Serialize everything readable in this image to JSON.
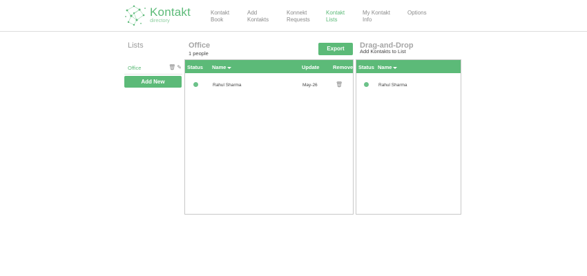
{
  "brand": {
    "name": "Kontakt",
    "tagline": "directory",
    "accent_color": "#5cba78"
  },
  "nav": [
    {
      "label": "Kontakt\nBook"
    },
    {
      "label": "Add\nKontakts"
    },
    {
      "label": "Konnekt\nRequests"
    },
    {
      "label": "Kontakt\nLists",
      "active": true
    },
    {
      "label": "My Kontakt\nInfo"
    },
    {
      "label": "Options"
    }
  ],
  "lists": {
    "title": "Lists",
    "items": [
      {
        "name": "Office",
        "icons": [
          "trash-icon",
          "edit-icon"
        ]
      }
    ],
    "add_button": "Add New"
  },
  "office_panel": {
    "title": "Office",
    "subtitle": "1 people",
    "export_button": "Export",
    "columns": {
      "status": "Status",
      "name": "Name",
      "update": "Update",
      "remove": "Remove"
    },
    "rows": [
      {
        "status": "online",
        "name": "Rahul Sharma",
        "update": "May-26"
      }
    ]
  },
  "dnd_panel": {
    "title": "Drag-and-Drop",
    "subtitle": "Add Kontakts to List",
    "columns": {
      "status": "Status",
      "name": "Name"
    },
    "rows": [
      {
        "status": "online",
        "name": "Rahul Sharma"
      }
    ]
  }
}
